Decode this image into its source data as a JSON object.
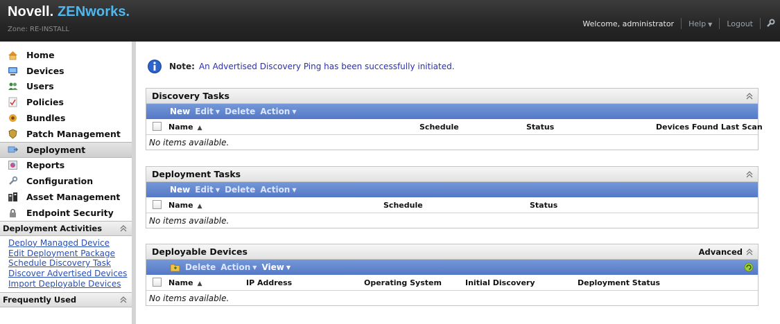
{
  "header": {
    "brand_novell": "Novell.",
    "brand_product": "ZENworks.",
    "zone": "Zone: RE-INSTALL",
    "welcome": "Welcome, administrator",
    "help": "Help",
    "logout": "Logout"
  },
  "nav": {
    "items": [
      {
        "label": "Home",
        "icon": "home-icon"
      },
      {
        "label": "Devices",
        "icon": "devices-icon"
      },
      {
        "label": "Users",
        "icon": "users-icon"
      },
      {
        "label": "Policies",
        "icon": "policies-icon"
      },
      {
        "label": "Bundles",
        "icon": "bundles-icon"
      },
      {
        "label": "Patch Management",
        "icon": "patch-management-icon"
      },
      {
        "label": "Deployment",
        "icon": "deployment-icon",
        "active": true
      },
      {
        "label": "Reports",
        "icon": "reports-icon"
      },
      {
        "label": "Configuration",
        "icon": "configuration-icon"
      },
      {
        "label": "Asset Management",
        "icon": "asset-management-icon"
      },
      {
        "label": "Endpoint Security",
        "icon": "endpoint-security-icon"
      }
    ]
  },
  "deployment_activities": {
    "title": "Deployment Activities",
    "links": [
      "Deploy Managed Device",
      "Edit Deployment Package",
      "Schedule Discovery Task",
      "Discover Advertised Devices",
      "Import Deployable Devices"
    ]
  },
  "frequently_used": {
    "title": "Frequently Used"
  },
  "note": {
    "label": "Note:",
    "message": "An Advertised Discovery Ping has been successfully initiated."
  },
  "discovery_tasks": {
    "title": "Discovery Tasks",
    "toolbar": {
      "new": "New",
      "edit": "Edit",
      "delete": "Delete",
      "action": "Action"
    },
    "columns": {
      "name": "Name",
      "schedule": "Schedule",
      "status": "Status",
      "devices_found": "Devices Found Last Scan"
    },
    "empty": "No items available."
  },
  "deployment_tasks": {
    "title": "Deployment Tasks",
    "toolbar": {
      "new": "New",
      "edit": "Edit",
      "delete": "Delete",
      "action": "Action"
    },
    "columns": {
      "name": "Name",
      "schedule": "Schedule",
      "status": "Status"
    },
    "empty": "No items available."
  },
  "deployable_devices": {
    "title": "Deployable Devices",
    "advanced": "Advanced",
    "toolbar": {
      "delete": "Delete",
      "action": "Action",
      "view": "View"
    },
    "columns": {
      "name": "Name",
      "ip": "IP Address",
      "os": "Operating System",
      "initial_discovery": "Initial Discovery",
      "deployment_status": "Deployment Status"
    },
    "empty": "No items available."
  },
  "colors": {
    "header_bg": "#262626",
    "brand_blue": "#4fb8f0",
    "toolbar_blue": "#5f83cc",
    "link_blue": "#2a4fb2",
    "note_text": "#2b2fb0"
  }
}
